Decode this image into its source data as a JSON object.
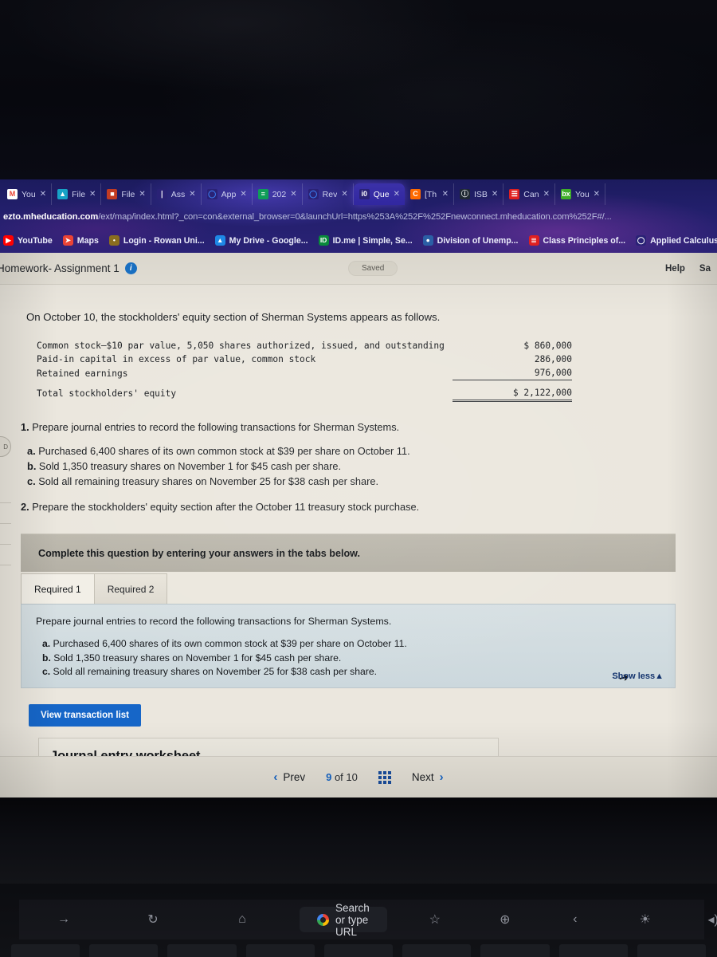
{
  "browser": {
    "tabs": [
      {
        "label": "You",
        "favicon": "gmail-icon",
        "color": "#ffffff",
        "glyph": "M",
        "glyph_color": "#ea4335",
        "active": false
      },
      {
        "label": "File",
        "favicon": "filen-icon",
        "color": "#17a2c6",
        "glyph": "▲",
        "glyph_color": "#ffffff",
        "active": false
      },
      {
        "label": "File",
        "favicon": "files-icon",
        "color": "#c23b22",
        "glyph": "■",
        "glyph_color": "#ffffff",
        "active": false
      },
      {
        "label": "Ass",
        "favicon": "doc-icon",
        "color": "#2a2276",
        "glyph": "❘",
        "glyph_color": "#ffffff",
        "active": false
      },
      {
        "label": "App",
        "favicon": "search-icon",
        "color": "#2a2276",
        "glyph": "◯",
        "glyph_color": "#3b82f6",
        "active": false
      },
      {
        "label": "202",
        "favicon": "sheets-icon",
        "color": "#0f9d58",
        "glyph": "≡",
        "glyph_color": "#ffffff",
        "active": false
      },
      {
        "label": "Rev",
        "favicon": "search-icon",
        "color": "#2a2276",
        "glyph": "◯",
        "glyph_color": "#3b82f6",
        "active": false
      },
      {
        "label": "Que",
        "favicon": "globe-icon",
        "color": "#2a2276",
        "glyph": "ἱ0",
        "glyph_color": "#ffffff",
        "active": true
      },
      {
        "label": "[Th",
        "favicon": "chegg-icon",
        "color": "#ff6a00",
        "glyph": "C",
        "glyph_color": "#ffffff",
        "active": false
      },
      {
        "label": "ISB",
        "favicon": "isbn-icon",
        "color": "#1f2933",
        "glyph": "ⓘ",
        "glyph_color": "#ffffff",
        "active": false
      },
      {
        "label": "Can",
        "favicon": "canvas-icon",
        "color": "#e02020",
        "glyph": "☰",
        "glyph_color": "#ffffff",
        "active": false
      },
      {
        "label": "You",
        "favicon": "bcc-icon",
        "color": "#3fae29",
        "glyph": "bx",
        "glyph_color": "#ffffff",
        "active": false
      }
    ],
    "url_host": "ezto.mheducation.com",
    "url_path": "/ext/map/index.html?_con=con&external_browser=0&launchUrl=https%253A%252F%252Fnewconnect.mheducation.com%252F#/...",
    "bookmarks": [
      {
        "label": "YouTube",
        "icon": "youtube-icon",
        "color": "#ff0000",
        "glyph": "▶"
      },
      {
        "label": "Maps",
        "icon": "maps-icon",
        "color": "#ea4335",
        "glyph": "➤"
      },
      {
        "label": "Login - Rowan Uni...",
        "icon": "rowan-icon",
        "color": "#8a6d1f",
        "glyph": "•"
      },
      {
        "label": "My Drive - Google...",
        "icon": "drive-icon",
        "color": "#1e88e5",
        "glyph": "▲"
      },
      {
        "label": "ID.me | Simple, Se...",
        "icon": "idme-icon",
        "color": "#0a8a3c",
        "glyph": "ID"
      },
      {
        "label": "Division of Unemp...",
        "icon": "nj-icon",
        "color": "#2b5fa5",
        "glyph": "●"
      },
      {
        "label": "Class Principles of...",
        "icon": "class-icon",
        "color": "#e02020",
        "glyph": "≣"
      },
      {
        "label": "Applied Calculus",
        "icon": "search-icon",
        "color": "#2a2276",
        "glyph": "◯"
      }
    ]
  },
  "app": {
    "header": {
      "title": "Homework- Assignment 1",
      "info_icon": "info-icon",
      "saved_label": "Saved",
      "help_label": "Help",
      "save_label": "Sa"
    },
    "prompt": "On October 10, the stockholders' equity section of Sherman Systems appears as follows.",
    "equity_table": {
      "rows": [
        {
          "label": "Common stock—$10 par value, 5,050 shares authorized, issued, and outstanding",
          "amount": "$ 860,000",
          "rule": "none"
        },
        {
          "label": "Paid-in capital in excess of par value, common stock",
          "amount": "286,000",
          "rule": "none"
        },
        {
          "label": "Retained earnings",
          "amount": "976,000",
          "rule": "single"
        },
        {
          "label": "Total stockholders' equity",
          "amount": "$ 2,122,000",
          "rule": "double"
        }
      ]
    },
    "requirements": {
      "req1_number": "1.",
      "req1_text": "Prepare journal entries to record the following transactions for Sherman Systems.",
      "items": [
        {
          "letter": "a.",
          "text": "Purchased 6,400 shares of its own common stock at $39 per share on October 11."
        },
        {
          "letter": "b.",
          "text": "Sold 1,350 treasury shares on November 1 for $45 cash per share."
        },
        {
          "letter": "c.",
          "text": "Sold all remaining treasury shares on November 25 for $38 cash per share."
        }
      ],
      "req2_number": "2.",
      "req2_text": "Prepare the stockholders' equity section after the October 11 treasury stock purchase."
    },
    "complete_bar": "Complete this question by entering your answers in the tabs below.",
    "answer_tabs": [
      {
        "label": "Required 1",
        "active": true
      },
      {
        "label": "Required 2",
        "active": false
      }
    ],
    "answer_panel": {
      "intro": "Prepare journal entries to record the following transactions for Sherman Systems.",
      "items": [
        {
          "letter": "a.",
          "text": "Purchased 6,400 shares of its own common stock at $39 per share on October 11."
        },
        {
          "letter": "b.",
          "text": "Sold 1,350 treasury shares on November 1 for $45 cash per share."
        },
        {
          "letter": "c.",
          "text": "Sold all remaining treasury shares on November 25 for $38 cash per share."
        }
      ],
      "show_less": "Show less▲"
    },
    "view_transaction_button": "View transaction list",
    "worksheet_title": "Journal entry worksheet",
    "pager": {
      "prev": "Prev",
      "current": "9",
      "of": "of",
      "total": "10",
      "next": "Next",
      "grid_icon": "grid-view-icon"
    }
  },
  "touchbar": {
    "keys": [
      {
        "icon": "forward-arrow-icon",
        "glyph": "→"
      },
      {
        "icon": "reload-icon",
        "glyph": "↻"
      },
      {
        "icon": "home-icon",
        "glyph": "⌂"
      }
    ],
    "search_placeholder": "Search or type URL",
    "google_icon": "google-g-icon",
    "right_keys": [
      {
        "icon": "star-icon",
        "glyph": "☆"
      },
      {
        "icon": "new-tab-icon",
        "glyph": "⊕"
      },
      {
        "icon": "back-bracket-icon",
        "glyph": "‹"
      },
      {
        "icon": "brightness-icon",
        "glyph": "☀"
      },
      {
        "icon": "volume-icon",
        "glyph": "◂))"
      }
    ]
  },
  "colors": {
    "accent_blue": "#1666c8",
    "chrome_purple": "#2a2276",
    "panel_blue": "#d7e0e3",
    "page_bg": "#ebe7de"
  }
}
